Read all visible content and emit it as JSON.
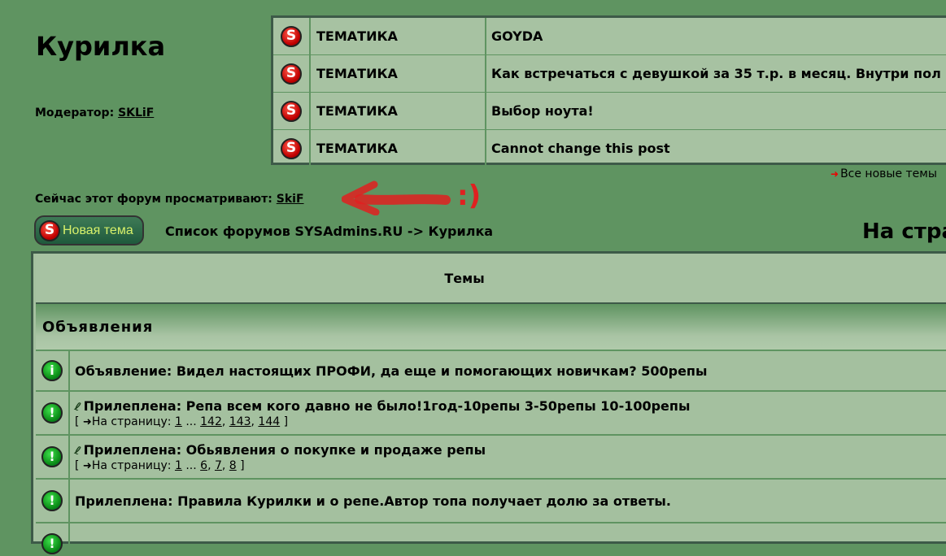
{
  "forum": {
    "title": "Курилка",
    "moderator_label": "Модератор:",
    "moderator_name": "SKLiF",
    "viewers_label": "Сейчас этот форум просматривают:",
    "viewers_name": "SkiF"
  },
  "recent_topics": [
    {
      "category": "ТЕМАТИКА",
      "title": "GOYDA"
    },
    {
      "category": "ТЕМАТИКА",
      "title": "Как встречаться с девушкой за 35 т.р. в месяц. Внутри пол"
    },
    {
      "category": "ТЕМАТИКА",
      "title": "Выбор ноута!"
    },
    {
      "category": "ТЕМАТИКА",
      "title": "Cannot change this post"
    }
  ],
  "all_new_topics": "Все новые темы",
  "annotation_text": ":)",
  "new_topic_button": "Новая тема",
  "breadcrumb": "Список форумов SYSAdmins.RU -> Курилка",
  "page_heading": "На стра",
  "table": {
    "header": "Темы",
    "section": "Объявления",
    "topics": [
      {
        "icon": "info-icon",
        "title": "Объявление: Видел настоящих ПРОФИ, да еще и помогающих новичкам? 500репы"
      },
      {
        "icon": "sticky-icon",
        "attachment": true,
        "title": "Прилеплена: Репа всем кого давно не было!1год-10репы 3-50репы 10-100репы",
        "pages_label": "На страницу:",
        "pages": [
          "1",
          "142",
          "143",
          "144"
        ]
      },
      {
        "icon": "sticky-icon",
        "attachment": true,
        "title": "Прилеплена: Обьявления о покупке и продаже репы",
        "pages_label": "На страницу:",
        "pages": [
          "1",
          "6",
          "7",
          "8"
        ]
      },
      {
        "icon": "sticky-icon",
        "title": "Прилеплена: Правила Курилки и о репе.Автор топа получает долю за ответы."
      }
    ]
  },
  "colors": {
    "background": "#5f9461",
    "cell": "#a7c2a2",
    "border": "#3d5a48",
    "accent_red": "#e02020"
  }
}
